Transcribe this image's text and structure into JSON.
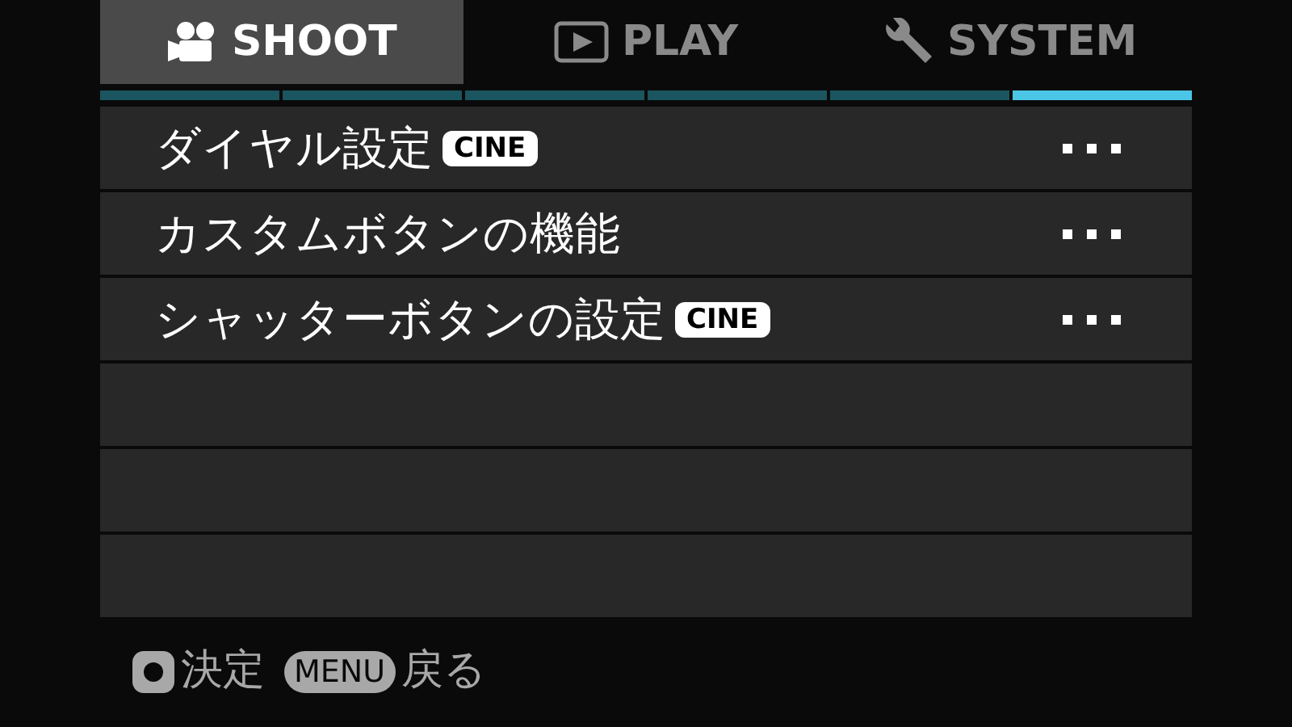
{
  "tabs": [
    {
      "label": "SHOOT",
      "kind": "camera",
      "selected": true
    },
    {
      "label": "PLAY",
      "kind": "play",
      "selected": false
    },
    {
      "label": "SYSTEM",
      "kind": "wrench",
      "selected": false
    }
  ],
  "pages": [
    {
      "selected": false
    },
    {
      "selected": false
    },
    {
      "selected": false
    },
    {
      "selected": false
    },
    {
      "selected": false
    },
    {
      "selected": true
    }
  ],
  "items": [
    {
      "label": "ダイヤル設定",
      "badge": "CINE"
    },
    {
      "label": "カスタムボタンの機能"
    },
    {
      "label": "シャッターボタンの設定",
      "badge": "CINE"
    }
  ],
  "footer": [
    {
      "kind": "ok",
      "label": "決定"
    },
    {
      "kind": "key",
      "key": "MENU",
      "label": "戻る"
    }
  ]
}
